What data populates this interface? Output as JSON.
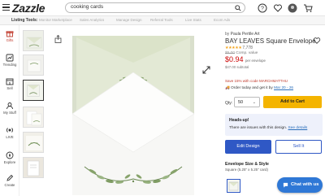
{
  "header": {
    "logo": "Zazzle",
    "search_value": "cooking cards"
  },
  "tools": {
    "label": "Listing Tools:",
    "items": [
      "Monitor Marketplace",
      "Sales Analytics",
      "Manage Design",
      "Referral Tools",
      "Live Stats",
      "Ecom Ads"
    ]
  },
  "rail": {
    "items": [
      {
        "label": "Gifts",
        "icon": "gift-icon"
      },
      {
        "label": "Trending",
        "icon": "trending-icon"
      },
      {
        "label": "Sell",
        "icon": "sell-icon"
      },
      {
        "label": "My Stuff",
        "icon": "user-icon"
      },
      {
        "label": "LIVE",
        "icon": "live-icon"
      },
      {
        "label": "Explore",
        "icon": "compass-icon"
      },
      {
        "label": "Create",
        "icon": "create-icon"
      }
    ]
  },
  "product": {
    "byline_prefix": "by",
    "byline_author": "Paula Pertile Art",
    "title": "BAY LEAVES Square Envelope",
    "stars": "★★★★★",
    "rating_count": "7,778",
    "was_price": "$5.00",
    "was_note": "Comp. value",
    "price": "$0.94",
    "price_unit": "per envelope",
    "subtotal": "$47.00 subtotal",
    "promo": "Save 15% with code MARCHMATTHU",
    "order_text": "Order today and get it by",
    "order_date": "Mar 20 - 26",
    "qty_label": "Qty:",
    "qty_value": "50",
    "add_to_cart": "Add to Cart",
    "heads_title": "Heads-up!",
    "heads_text": "There are issues with this design.",
    "see_details": "See details",
    "edit_design": "Edit Design",
    "sell_it": "Sell It",
    "size_title": "Envelope Size & Style",
    "size_sub": "Square (5.25\" x 5.25\" card)"
  },
  "chat": {
    "label": "Chat with us"
  },
  "colors": {
    "accent_blue": "#2f58c5",
    "cart_yellow": "#f4b400",
    "price_red": "#cc0000"
  }
}
